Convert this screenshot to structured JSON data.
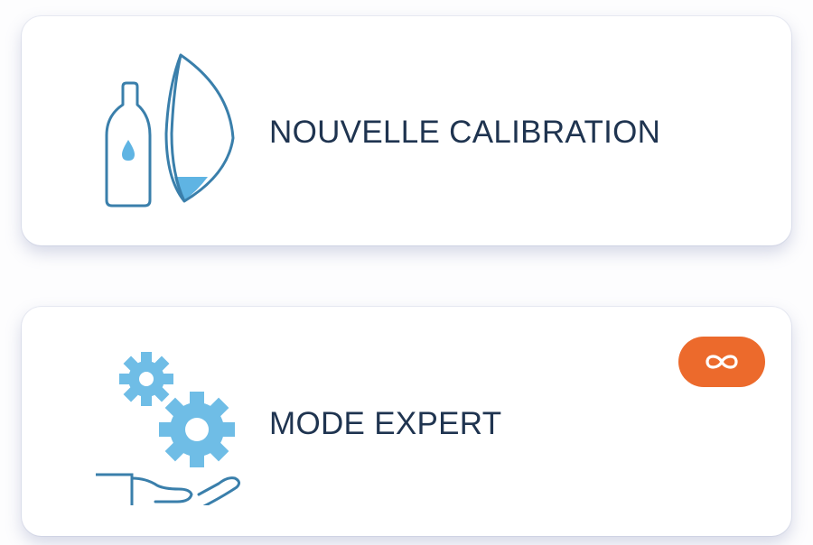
{
  "cards": [
    {
      "label": "NOUVELLE CALIBRATION",
      "icon": "solution-bottle-and-lens-icon"
    },
    {
      "label": "MODE EXPERT",
      "icon": "gears-in-hand-icon",
      "badge_icon": "infinity-icon"
    }
  ],
  "colors": {
    "icon_stroke": "#3a7fab",
    "icon_fill": "#5fb4e3",
    "label_text": "#1f3450",
    "badge": "#ec6a2c",
    "card_background": "#ffffff"
  }
}
